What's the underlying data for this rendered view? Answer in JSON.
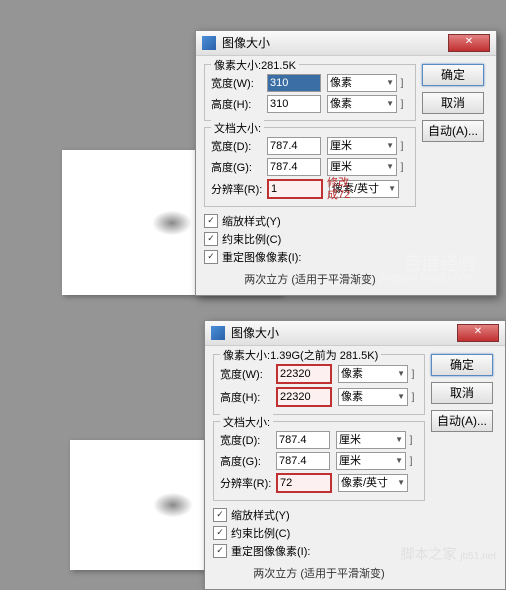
{
  "dialog_title": "图像大小",
  "buttons": {
    "ok": "确定",
    "cancel": "取消",
    "auto": "自动(A)..."
  },
  "group_labels": {
    "pixel": "像素大小:",
    "doc": "文档大小:"
  },
  "field_labels": {
    "width_w": "宽度(W):",
    "height_h": "高度(H):",
    "width_d": "宽度(D):",
    "height_g": "高度(G):",
    "resolution": "分辨率(R):"
  },
  "units": {
    "pixel": "像素",
    "mm": "厘米",
    "ppi": "像素/英寸"
  },
  "checks": {
    "scale_styles": "缩放样式(Y)",
    "constrain": "约束比例(C)",
    "resample": "重定图像像素(I):"
  },
  "footer": "两次立方 (适用于平滑渐变)",
  "top": {
    "size_info": "281.5K",
    "pw": "310",
    "ph": "310",
    "dw": "787.4",
    "dh": "787.4",
    "res": "1"
  },
  "bottom": {
    "size_info": "1.39G(之前为 281.5K)",
    "pw": "22320",
    "ph": "22320",
    "dw": "787.4",
    "dh": "787.4",
    "res": "72"
  },
  "annotation": {
    "l1": "修改",
    "l2": "成72"
  },
  "watermarks": {
    "a": "百度经验",
    "b": "jingyan.baidu.com",
    "c": "脚本之家",
    "d": "jb51.net"
  }
}
